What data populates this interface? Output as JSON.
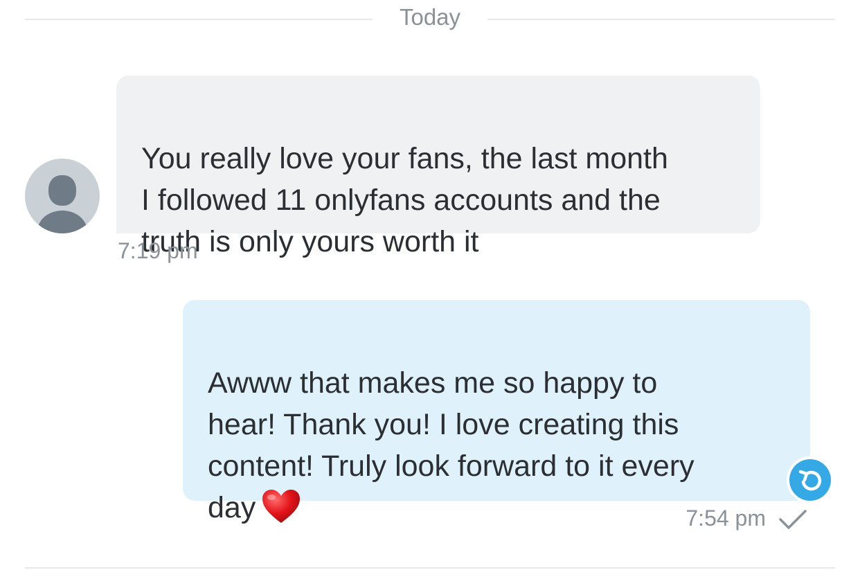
{
  "date_divider": {
    "label": "Today"
  },
  "messages": [
    {
      "direction": "incoming",
      "text": "You really love your fans, the last month\nI followed 11 onlyfans accounts and the\ntruth is only yours worth it",
      "time": "7:19 pm",
      "avatar_icon": "default-user-avatar"
    },
    {
      "direction": "outgoing",
      "text": "Awww that makes me so happy to\nhear! Thank you! I love creating this\ncontent! Truly look forward to it every\nday",
      "emoji": "red-heart",
      "time": "7:54 pm",
      "status_icon": "check-icon",
      "action_icon": "reply-undo-icon"
    }
  ],
  "colors": {
    "incoming_bubble": "#eff1f3",
    "outgoing_bubble": "#dff1fb",
    "accent": "#35a9e6",
    "muted_text": "#8a9199",
    "text": "#2b2f33"
  }
}
